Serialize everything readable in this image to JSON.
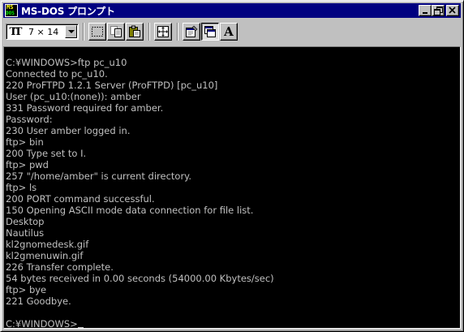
{
  "window": {
    "title": "MS-DOS プロンプト",
    "icon": "msdos-icon",
    "icon_lines": [
      "MS",
      "DOS"
    ],
    "controls": [
      "minimize",
      "restore",
      "close"
    ]
  },
  "toolbar": {
    "font_size_value": "7 × 14",
    "font_prefix_icon": "truetype-icon",
    "buttons": [
      {
        "name": "mark-button",
        "icon": "mark-icon"
      },
      {
        "name": "copy-button",
        "icon": "copy-icon"
      },
      {
        "name": "paste-button",
        "icon": "paste-icon"
      },
      {
        "name": "fullscreen-button",
        "icon": "fullscreen-icon"
      },
      {
        "name": "properties-button",
        "icon": "properties-icon"
      },
      {
        "name": "background-button",
        "icon": "background-icon"
      },
      {
        "name": "font-button",
        "icon": "font-icon",
        "glyph": "A"
      }
    ]
  },
  "console": {
    "lines": [
      "C:¥WINDOWS>ftp pc_u10",
      "Connected to pc_u10.",
      "220 ProFTPD 1.2.1 Server (ProFTPD) [pc_u10]",
      "User (pc_u10:(none)): amber",
      "331 Password required for amber.",
      "Password:",
      "230 User amber logged in.",
      "ftp> bin",
      "200 Type set to I.",
      "ftp> pwd",
      "257 \"/home/amber\" is current directory.",
      "ftp> ls",
      "200 PORT command successful.",
      "150 Opening ASCII mode data connection for file list.",
      "Desktop",
      "Nautilus",
      "kl2gnomedesk.gif",
      "kl2gmenuwin.gif",
      "226 Transfer complete.",
      "54 bytes received in 0.00 seconds (54000.00 Kbytes/sec)",
      "ftp> bye",
      "221 Goodbye."
    ],
    "prompt": "C:¥WINDOWS>"
  },
  "colors": {
    "titlebar": "#000080",
    "console_bg": "#000000",
    "console_fg": "#c0c0c0",
    "chrome": "#c0c0c0"
  }
}
